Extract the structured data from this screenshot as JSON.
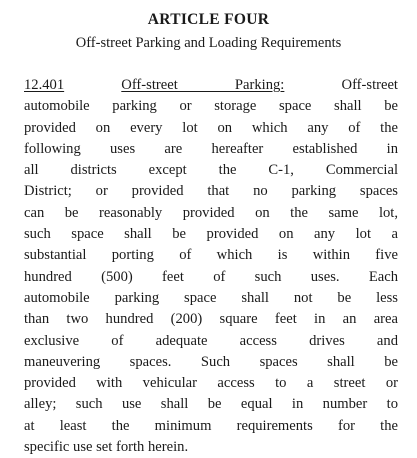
{
  "article": {
    "title": "ARTICLE FOUR",
    "subtitle": "Off-street Parking and Loading Requirements"
  },
  "section": {
    "number": "12.401",
    "heading": "Off-street Parking:",
    "first_line_rest": "Off-street",
    "lines": [
      "automobile parking or storage space shall be",
      "provided on every lot on which any of the",
      "following uses are hereafter established in",
      "all districts except the C-1, Commercial",
      "District; or provided that no parking spaces",
      "can be reasonably provided on the same lot,",
      "such space shall be provided on any lot a",
      "substantial porting of which is within five",
      "hundred (500) feet of such uses. Each",
      "automobile parking space shall not be less",
      "than two hundred (200) square feet in an area",
      "exclusive of adequate access drives and",
      "maneuvering spaces. Such spaces shall be",
      "provided with vehicular access to a street or",
      "alley; such use shall be equal in number to",
      "at least the minimum requirements for the",
      "specific use set forth herein."
    ]
  }
}
